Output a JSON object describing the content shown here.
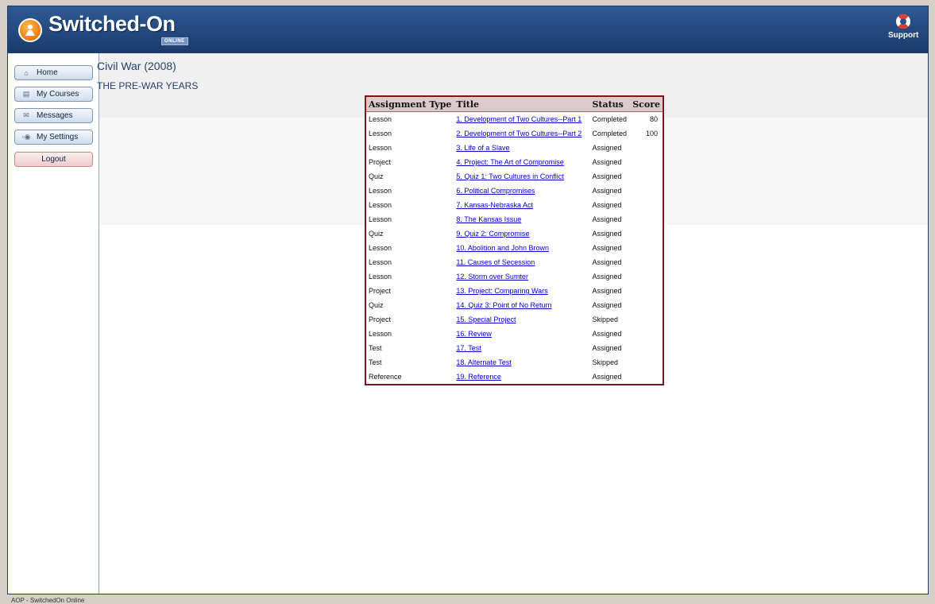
{
  "header": {
    "logo_title": "Switched-On",
    "logo_subtitle": "ONLINE",
    "support_label": "Support",
    "support_icon": "lifebuoy-icon",
    "logo_icon": "person-badge-icon"
  },
  "sidebar": {
    "items": [
      {
        "label": "Home",
        "icon": "home-icon",
        "glyph": "⌂"
      },
      {
        "label": "My Courses",
        "icon": "document-icon",
        "glyph": "▤"
      },
      {
        "label": "Messages",
        "icon": "envelope-icon",
        "glyph": "✉"
      },
      {
        "label": "My Settings",
        "icon": "settings-icon",
        "glyph": "◦◉"
      },
      {
        "label": "Logout",
        "icon": "",
        "glyph": ""
      }
    ]
  },
  "course": {
    "title": "Civil War (2008)",
    "unit": "THE PRE-WAR YEARS"
  },
  "table": {
    "headers": [
      "Assignment Type",
      "Title",
      "Status",
      "Score"
    ],
    "rows": [
      {
        "type": "Lesson",
        "title": "1. Development of Two Cultures--Part 1",
        "status": "Completed",
        "score": "80"
      },
      {
        "type": "Lesson",
        "title": "2. Development of Two Cultures--Part 2",
        "status": "Completed",
        "score": "100"
      },
      {
        "type": "Lesson",
        "title": "3. Life of a Slave",
        "status": "Assigned",
        "score": ""
      },
      {
        "type": "Project",
        "title": "4. Project: The Art of Compromise",
        "status": "Assigned",
        "score": ""
      },
      {
        "type": "Quiz",
        "title": "5. Quiz 1: Two Cultures in Conflict",
        "status": "Assigned",
        "score": ""
      },
      {
        "type": "Lesson",
        "title": "6. Political Compromises",
        "status": "Assigned",
        "score": ""
      },
      {
        "type": "Lesson",
        "title": "7. Kansas-Nebraska Act",
        "status": "Assigned",
        "score": ""
      },
      {
        "type": "Lesson",
        "title": "8. The Kansas Issue",
        "status": "Assigned",
        "score": ""
      },
      {
        "type": "Quiz",
        "title": "9. Quiz 2: Compromise",
        "status": "Assigned",
        "score": ""
      },
      {
        "type": "Lesson",
        "title": "10. Abolition and John Brown",
        "status": "Assigned",
        "score": ""
      },
      {
        "type": "Lesson",
        "title": "11. Causes of Secession",
        "status": "Assigned",
        "score": ""
      },
      {
        "type": "Lesson",
        "title": "12. Storm over Sumter",
        "status": "Assigned",
        "score": ""
      },
      {
        "type": "Project",
        "title": "13. Project: Comparing Wars",
        "status": "Assigned",
        "score": ""
      },
      {
        "type": "Quiz",
        "title": "14. Quiz 3: Point of No Return",
        "status": "Assigned",
        "score": ""
      },
      {
        "type": "Project",
        "title": "15. Special Project",
        "status": "Skipped",
        "score": ""
      },
      {
        "type": "Lesson",
        "title": "16. Review",
        "status": "Assigned",
        "score": ""
      },
      {
        "type": "Test",
        "title": "17. Test",
        "status": "Assigned",
        "score": ""
      },
      {
        "type": "Test",
        "title": "18. Alternate Test",
        "status": "Skipped",
        "score": ""
      },
      {
        "type": "Reference",
        "title": "19. Reference",
        "status": "Assigned",
        "score": ""
      }
    ]
  },
  "footer": {
    "text": "AOP - SwitchedOn Online"
  },
  "colors": {
    "header_blue": "#23497f",
    "table_border": "#7a1717",
    "table_header_bg": "#dccaca",
    "link": "#0000cc"
  }
}
